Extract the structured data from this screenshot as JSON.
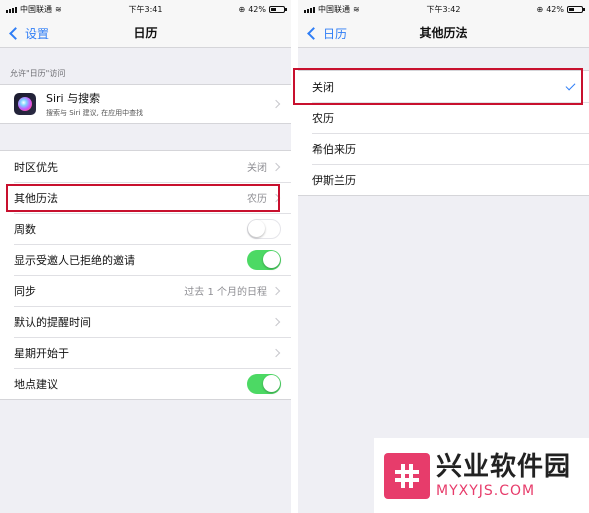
{
  "left": {
    "status": {
      "carrier": "中国联通",
      "time": "下午3:41",
      "battery": "42%",
      "battery_level": 0.42
    },
    "nav": {
      "back": "设置",
      "title": "日历"
    },
    "access_header": "允许\"日历\"访问",
    "siri": {
      "title": "Siri 与搜索",
      "subtitle": "搜索与 Siri 建议, 在应用中查找"
    },
    "rows": [
      {
        "label": "时区优先",
        "value": "关闭",
        "type": "chevron"
      },
      {
        "label": "其他历法",
        "value": "农历",
        "type": "chevron",
        "highlighted": true
      },
      {
        "label": "周数",
        "type": "toggle",
        "on": false
      },
      {
        "label": "显示受邀人已拒绝的邀请",
        "type": "toggle",
        "on": true
      },
      {
        "label": "同步",
        "value": "过去 1 个月的日程",
        "type": "chevron"
      },
      {
        "label": "默认的提醒时间",
        "value": "",
        "type": "chevron"
      },
      {
        "label": "星期开始于",
        "value": "",
        "type": "chevron"
      },
      {
        "label": "地点建议",
        "type": "toggle",
        "on": true
      }
    ]
  },
  "right": {
    "status": {
      "carrier": "中国联通",
      "time": "下午3:42",
      "battery": "42%",
      "battery_level": 0.42
    },
    "nav": {
      "back": "日历",
      "title": "其他历法"
    },
    "options": [
      {
        "label": "关闭",
        "selected": true
      },
      {
        "label": "农历",
        "selected": false
      },
      {
        "label": "希伯来历",
        "selected": false
      },
      {
        "label": "伊斯兰历",
        "selected": false
      }
    ]
  },
  "watermark": {
    "cn": "兴业软件园",
    "en": "MYXYJS.COM",
    "symbol": "#"
  },
  "colors": {
    "accent": "#2f7ef6",
    "toggle_on": "#4cd964",
    "highlight": "#c8102e",
    "watermark": "#e73c6b"
  }
}
